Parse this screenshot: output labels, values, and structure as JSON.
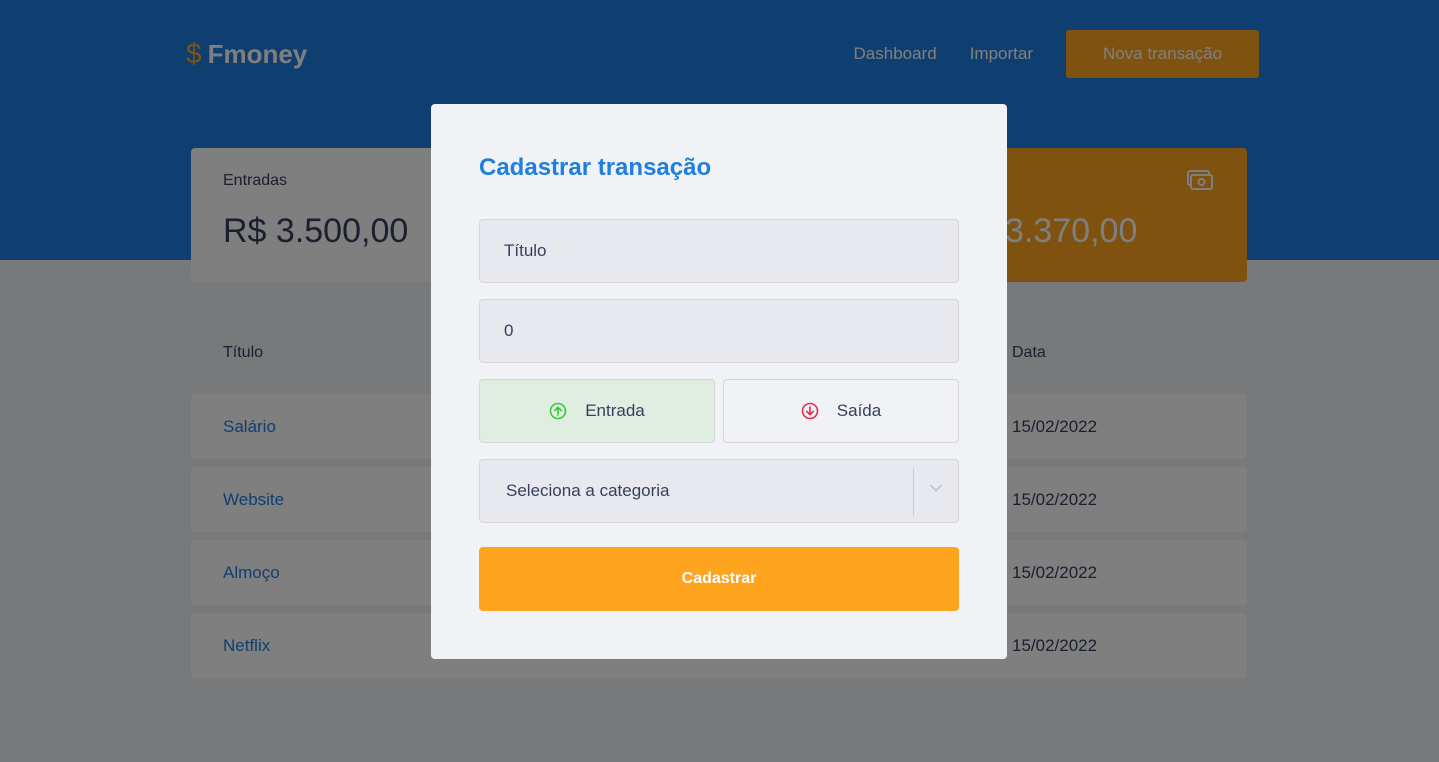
{
  "header": {
    "logo_symbol": "$",
    "brand": "Fmoney",
    "nav": {
      "dashboard": "Dashboard",
      "import": "Importar",
      "new_transaction": "Nova transação"
    }
  },
  "summary": {
    "income": {
      "label": "Entradas",
      "value": "R$ 3.500,00"
    },
    "total": {
      "value": "3.370,00",
      "icon": "money-icon"
    }
  },
  "table": {
    "columns": {
      "title": "Título",
      "date": "Data"
    },
    "rows": [
      {
        "title": "Salário",
        "date": "15/02/2022"
      },
      {
        "title": "Website",
        "date": "15/02/2022"
      },
      {
        "title": "Almoço",
        "date": "15/02/2022"
      },
      {
        "title": "Netflix",
        "date": "15/02/2022"
      }
    ]
  },
  "modal": {
    "title": "Cadastrar transação",
    "title_placeholder": "Título",
    "amount_value": "0",
    "type_income": "Entrada",
    "type_outcome": "Saída",
    "category_placeholder": "Seleciona a categoria",
    "submit": "Cadastrar"
  },
  "colors": {
    "primary": "#1f7fe0",
    "accent": "#ffa41f",
    "income": "#33cc33",
    "outcome": "#e52e4d"
  }
}
